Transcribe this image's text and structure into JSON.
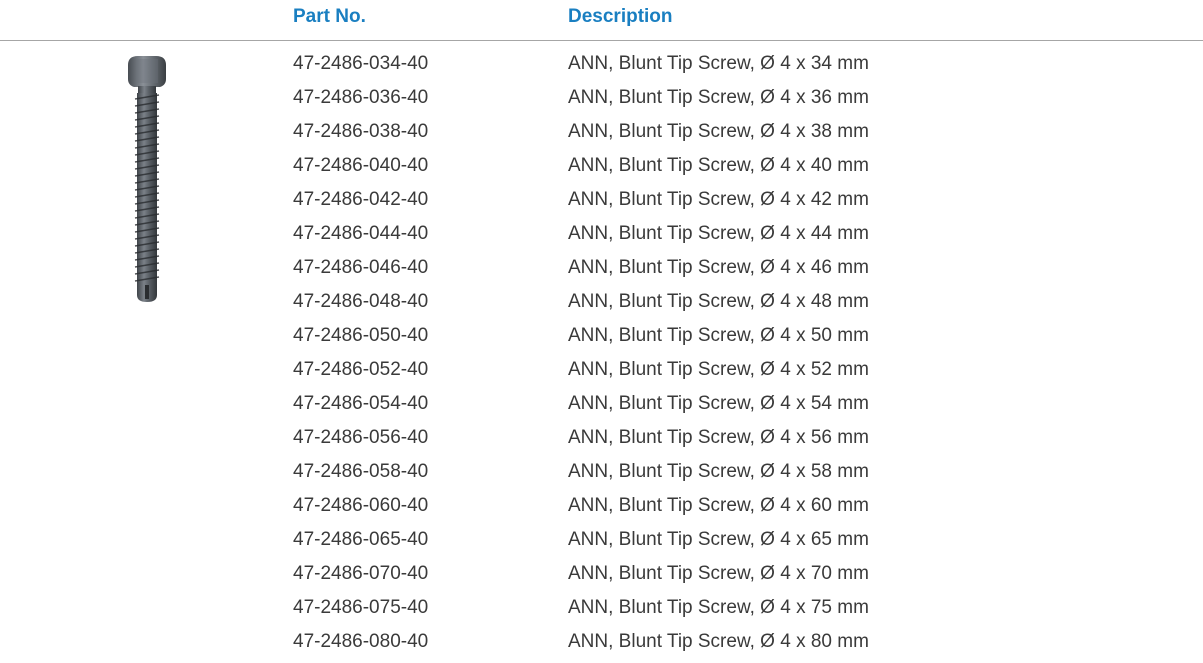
{
  "table": {
    "headers": {
      "part_no": "Part No.",
      "description": "Description"
    },
    "rows": [
      {
        "part_no": "47-2486-034-40",
        "description": "ANN, Blunt Tip Screw, Ø 4 x 34 mm"
      },
      {
        "part_no": "47-2486-036-40",
        "description": "ANN, Blunt Tip Screw, Ø 4 x 36 mm"
      },
      {
        "part_no": "47-2486-038-40",
        "description": "ANN, Blunt Tip Screw, Ø 4 x 38 mm"
      },
      {
        "part_no": "47-2486-040-40",
        "description": "ANN, Blunt Tip Screw, Ø 4 x 40 mm"
      },
      {
        "part_no": "47-2486-042-40",
        "description": "ANN, Blunt Tip Screw, Ø 4 x 42 mm"
      },
      {
        "part_no": "47-2486-044-40",
        "description": "ANN, Blunt Tip Screw, Ø 4 x 44 mm"
      },
      {
        "part_no": "47-2486-046-40",
        "description": "ANN, Blunt Tip Screw, Ø 4 x 46 mm"
      },
      {
        "part_no": "47-2486-048-40",
        "description": "ANN, Blunt Tip Screw, Ø 4 x 48 mm"
      },
      {
        "part_no": "47-2486-050-40",
        "description": "ANN, Blunt Tip Screw, Ø 4 x 50 mm"
      },
      {
        "part_no": "47-2486-052-40",
        "description": "ANN, Blunt Tip Screw, Ø 4 x 52 mm"
      },
      {
        "part_no": "47-2486-054-40",
        "description": "ANN, Blunt Tip Screw, Ø 4 x 54 mm"
      },
      {
        "part_no": "47-2486-056-40",
        "description": "ANN, Blunt Tip Screw, Ø 4 x 56 mm"
      },
      {
        "part_no": "47-2486-058-40",
        "description": "ANN, Blunt Tip Screw, Ø 4 x 58 mm"
      },
      {
        "part_no": "47-2486-060-40",
        "description": "ANN, Blunt Tip Screw, Ø 4 x 60 mm"
      },
      {
        "part_no": "47-2486-065-40",
        "description": "ANN, Blunt Tip Screw, Ø 4 x 65 mm"
      },
      {
        "part_no": "47-2486-070-40",
        "description": "ANN, Blunt Tip Screw, Ø 4 x 70 mm"
      },
      {
        "part_no": "47-2486-075-40",
        "description": "ANN, Blunt Tip Screw, Ø 4 x 75 mm"
      },
      {
        "part_no": "47-2486-080-40",
        "description": "ANN, Blunt Tip Screw, Ø 4 x 80 mm"
      }
    ]
  },
  "image": {
    "icon": "screw-icon"
  },
  "colors": {
    "header_text": "#1a7fc1",
    "body_text": "#3a3a3a",
    "rule": "#a6a6a6",
    "screw_metal": "#5a6066"
  }
}
